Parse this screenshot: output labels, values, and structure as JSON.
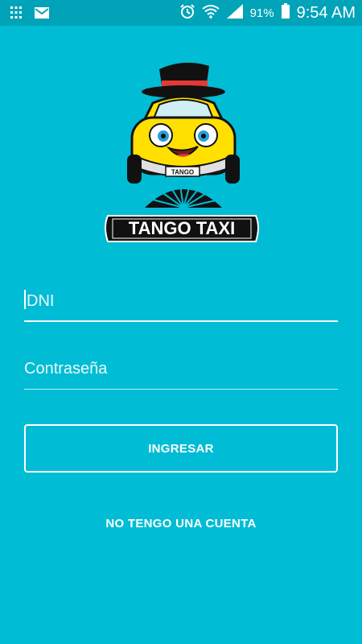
{
  "status_bar": {
    "battery": "91%",
    "time": "9:54 AM",
    "icons": [
      "apps-grid-icon",
      "gmail-icon",
      "alarm-icon",
      "wifi-icon",
      "signal-icon",
      "battery-icon"
    ]
  },
  "logo": {
    "brand": "TANGO TAXI",
    "plate": "TANGO"
  },
  "form": {
    "dni_placeholder": "DNI",
    "password_placeholder": "Contraseña"
  },
  "buttons": {
    "login": "INGRESAR",
    "no_account": "NO TENGO UNA CUENTA"
  },
  "colors": {
    "background": "#00BCD4",
    "status_bar": "#00A3B8",
    "car_yellow": "#FFE000",
    "hat": "#111111",
    "hat_band": "#E53935"
  }
}
